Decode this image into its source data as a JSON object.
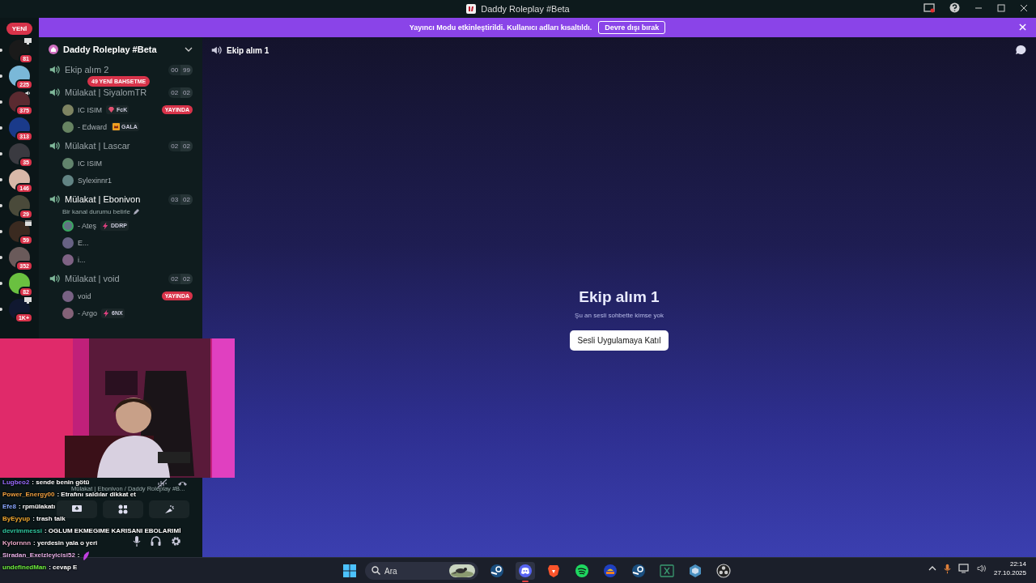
{
  "window": {
    "title": "Daddy Roleplay #Beta"
  },
  "server_rail": {
    "new_pill": "YENİ",
    "servers": [
      {
        "badge": "81",
        "color": "#1a1a1a",
        "kind": "screen"
      },
      {
        "badge": "225",
        "color": "#7ab8d8"
      },
      {
        "badge": "375",
        "color": "#5a2a30",
        "kind": "speaker"
      },
      {
        "badge": "313",
        "color": "#1a3a8a"
      },
      {
        "badge": "35",
        "color": "#3a3a40"
      },
      {
        "badge": "146",
        "color": "#d8b8a8"
      },
      {
        "badge": "29",
        "color": "#4a4a3a"
      },
      {
        "badge": "59",
        "color": "#3a2a20",
        "kind": "calendar"
      },
      {
        "badge": "352",
        "color": "#6a5a5a"
      },
      {
        "badge": "82",
        "color": "#6ac040"
      },
      {
        "badge": "1K+",
        "color": "#101830",
        "kind": "screen"
      }
    ]
  },
  "banner": {
    "text": "Yayıncı Modu etkinleştirildi. Kullanıcı adları kısaltıldı.",
    "button": "Devre dışı bırak"
  },
  "server": {
    "name": "Daddy Roleplay #Beta",
    "mention_pill": "49 YENİ BAHSETME",
    "channels": [
      {
        "name": "Ekip alım 2",
        "connected": false,
        "counts": [
          "00",
          "99"
        ]
      },
      {
        "name": "Mülakat | SiyalomTR",
        "connected": false,
        "counts": [
          "02",
          "02"
        ],
        "users": [
          {
            "name": "IC ISIM",
            "speaking": false,
            "tag": {
              "kind": "gem",
              "text": "FcK"
            },
            "live_badge": "YAYINDA"
          },
          {
            "name": "- Edward",
            "speaking": false,
            "tag": {
              "kind": "crown",
              "text": "GALA"
            }
          }
        ]
      },
      {
        "name": "Mülakat | Lascar",
        "connected": false,
        "counts": [
          "02",
          "02"
        ],
        "users": [
          {
            "name": "IC ISIM",
            "speaking": false
          },
          {
            "name": "Sylexinnr1",
            "speaking": false
          }
        ]
      },
      {
        "name": "Mülakat | Ebonivon",
        "connected": true,
        "counts": [
          "03",
          "02"
        ],
        "status": "Bir kanal durumu belirle",
        "users": [
          {
            "name": "- Ateş",
            "speaking": true,
            "tag": {
              "kind": "bolt",
              "text": "DDRP"
            }
          },
          {
            "name": "E...",
            "speaking": false
          },
          {
            "name": "i...",
            "speaking": false
          }
        ]
      },
      {
        "name": "Mülakat | void",
        "connected": false,
        "counts": [
          "02",
          "02"
        ],
        "users": [
          {
            "name": "void",
            "speaking": false,
            "live_badge": "YAYINDA"
          },
          {
            "name": "- Argo",
            "speaking": false,
            "tag": {
              "kind": "bolt",
              "text": "6NX"
            }
          }
        ]
      }
    ]
  },
  "main": {
    "channel": "Ekip alım 1",
    "title": "Ekip alım 1",
    "subtitle": "Şu an sesli sohbette kimse yok",
    "join_button": "Sesli Uygulamaya Katıl"
  },
  "voice_panel": {
    "status": "Mülakat | Ebonivon / Daddy Roleplay #B..."
  },
  "chat": [
    {
      "user": "Lugbeo2",
      "color": "#9a6cff",
      "text": ": sende benin götü"
    },
    {
      "user": "Power_Energy00",
      "color": "#f0a040",
      "text": ": Etrafını saldılar dikkat et"
    },
    {
      "user": "Efe8",
      "color": "#8aa8ff",
      "text": ": rpmülakatı"
    },
    {
      "user": "ByEyyup",
      "color": "#f0a830",
      "text": ": trash talk"
    },
    {
      "user": "devrimmessi",
      "color": "#30c8a0",
      "text": ": OGLUM EKMEGIME KARISANI EBOLARIMİ"
    },
    {
      "user": "Kylornnn",
      "color": "#e8a8c8",
      "text": ": yerdesin yala o yeri"
    },
    {
      "user": "Siradan_Exelzleyicisi52",
      "color": "#e8b0e8",
      "text": ":",
      "emote": true
    },
    {
      "user": "undefinedMan",
      "color": "#70f040",
      "text": ": cevap E"
    }
  ],
  "taskbar": {
    "search_placeholder": "Ara",
    "apps": [
      {
        "kind": "steam",
        "selected": false
      },
      {
        "kind": "discord",
        "selected": true
      },
      {
        "kind": "brave",
        "selected": false
      },
      {
        "kind": "spotify",
        "selected": false
      },
      {
        "kind": "game",
        "selected": false
      },
      {
        "kind": "steam",
        "selected": false
      },
      {
        "kind": "sheet",
        "selected": false
      },
      {
        "kind": "cube",
        "selected": false
      },
      {
        "kind": "obs",
        "selected": false
      }
    ],
    "time": "22:14",
    "date": "27.10.2025"
  }
}
